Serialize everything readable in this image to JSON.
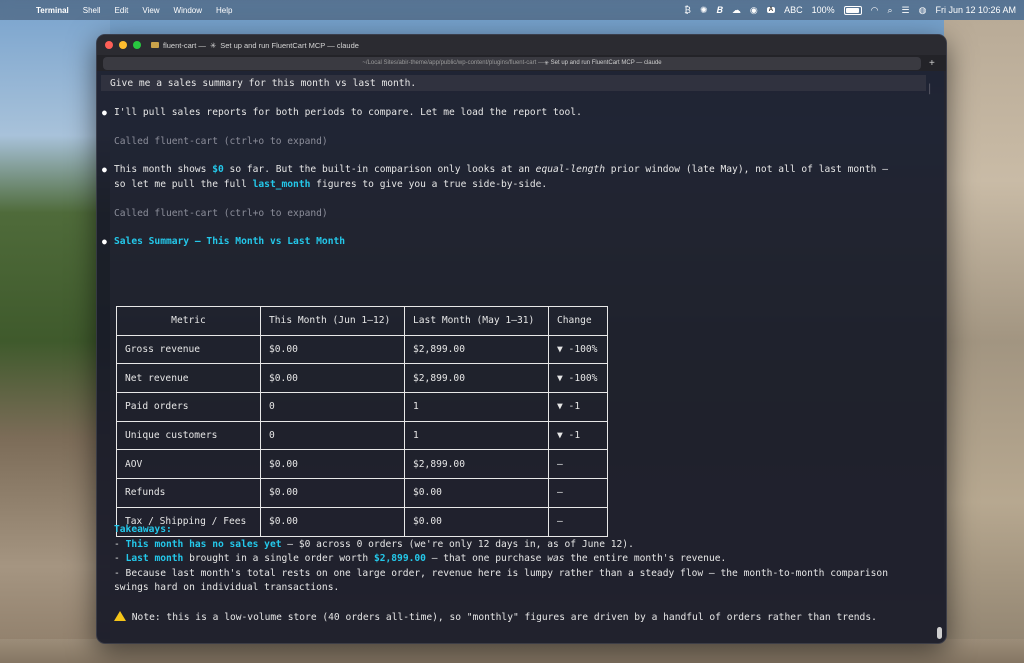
{
  "menubar": {
    "app_name": "Terminal",
    "items": [
      "Shell",
      "Edit",
      "View",
      "Window",
      "Help"
    ],
    "input_source": "ABC",
    "battery": "100%",
    "clock": "Fri Jun 12  10:26 AM"
  },
  "window": {
    "title_prefix": "fluent-cart — ",
    "title_marker": "✳",
    "title_main": "Set up and run FluentCart MCP — claude",
    "tab_path": "~/Local Sites/abir-theme/app/public/wp-content/plugins/fluent-cart — ",
    "tab_marker": "✳",
    "tab_title": "Set up and run FluentCart MCP — claude",
    "new_tab_symbol": "+"
  },
  "transcript": {
    "user_prompt": "Give me a sales summary for this month vs last month.",
    "msg1": "I'll pull sales reports for both periods to compare. Let me load the report tool.",
    "tool_call_1": "Called fluent-cart (ctrl+o to expand)",
    "msg2_a": "This month shows ",
    "msg2_b": "$0",
    "msg2_c": " so far. But the built-in comparison only looks at an ",
    "msg2_d": "equal-length",
    "msg2_e": " prior window (late May), not all of last month —",
    "msg2_f": "so let me pull the full ",
    "msg2_g": "last_month",
    "msg2_h": " figures to give you a true side-by-side.",
    "tool_call_2": "Called fluent-cart (ctrl+o to expand)",
    "summary_heading": "Sales Summary — This Month vs Last Month"
  },
  "table": {
    "headers": [
      "Metric",
      "This Month (Jun 1–12)",
      "Last Month (May 1–31)",
      "Change"
    ],
    "rows": [
      [
        "Gross revenue",
        "$0.00",
        "$2,899.00",
        "▼ -100%"
      ],
      [
        "Net revenue",
        "$0.00",
        "$2,899.00",
        "▼ -100%"
      ],
      [
        "Paid orders",
        "0",
        "1",
        "▼ -1"
      ],
      [
        "Unique customers",
        "0",
        "1",
        "▼ -1"
      ],
      [
        "AOV",
        "$0.00",
        "$2,899.00",
        "—"
      ],
      [
        "Refunds",
        "$0.00",
        "$0.00",
        "—"
      ],
      [
        "Tax / Shipping / Fees",
        "$0.00",
        "$0.00",
        "—"
      ]
    ]
  },
  "takeaways": {
    "heading": "Takeaways:",
    "t1_prefix": "- ",
    "t1_bold": "This month has no sales yet",
    "t1_rest": " — $0 across 0 orders (we're only 12 days in, as of June 12).",
    "t2_prefix": "- ",
    "t2_bold": "Last month",
    "t2_mid": " brought in a single order worth ",
    "t2_amount": "$2,899.00",
    "t2_rest_a": " — that one purchase ",
    "t2_was": "was",
    "t2_rest_b": " the entire month's revenue.",
    "t3_line1": "- Because last month's total rests on one large order, revenue here is lumpy rather than a steady flow — the month-to-month comparison",
    "t3_line2": "swings hard on individual transactions.",
    "note": " Note: this is a low-volume store (40 orders all-time), so \"monthly\" figures are driven by a handful of orders rather than trends."
  },
  "colors": {
    "accent_cyan": "#24c8ea",
    "terminal_bg": "#181a28",
    "warning_yellow": "#f5c518"
  },
  "icons": [
    "apple-icon",
    "wifi-icon",
    "search-icon",
    "control-center-icon",
    "battery-icon",
    "folder-icon",
    "warning-icon"
  ]
}
